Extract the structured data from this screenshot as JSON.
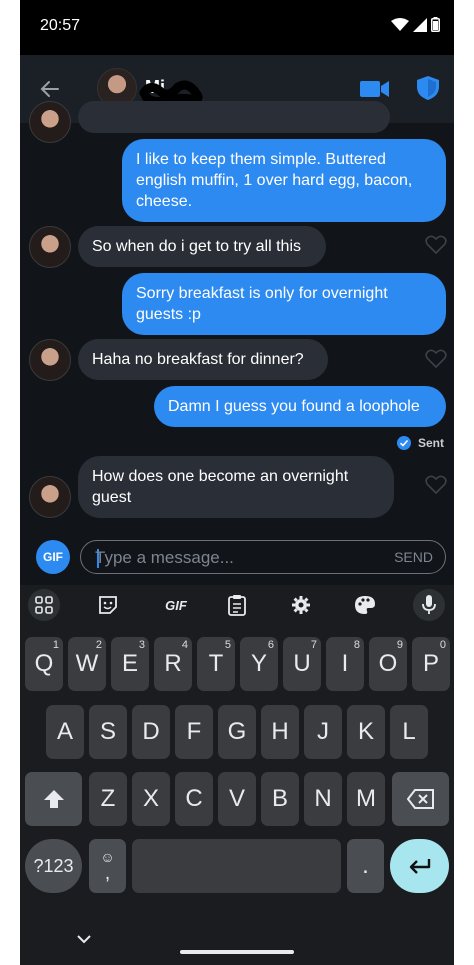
{
  "status": {
    "time": "20:57"
  },
  "header": {
    "contact_name": "Mi"
  },
  "messages": [
    {
      "dir": "out",
      "text": "I like to keep them simple. Buttered english muffin, 1 over hard egg, bacon, cheese."
    },
    {
      "dir": "in",
      "text": "So when do i get to try all this"
    },
    {
      "dir": "out",
      "text": "Sorry breakfast is only for overnight guests :p"
    },
    {
      "dir": "in",
      "text": "Haha no breakfast for dinner?"
    },
    {
      "dir": "out",
      "text": "Damn I guess you found a loophole"
    },
    {
      "dir": "in",
      "text": "How does one become an overnight guest"
    }
  ],
  "sent_label": "Sent",
  "composer": {
    "gif_label": "GIF",
    "placeholder": "Type a message...",
    "send_label": "SEND"
  },
  "keyboard": {
    "toolbar_gif": "GIF",
    "row1": [
      {
        "k": "Q",
        "h": "1"
      },
      {
        "k": "W",
        "h": "2"
      },
      {
        "k": "E",
        "h": "3"
      },
      {
        "k": "R",
        "h": "4"
      },
      {
        "k": "T",
        "h": "5"
      },
      {
        "k": "Y",
        "h": "6"
      },
      {
        "k": "U",
        "h": "7"
      },
      {
        "k": "I",
        "h": "8"
      },
      {
        "k": "O",
        "h": "9"
      },
      {
        "k": "P",
        "h": "0"
      }
    ],
    "row2": [
      "A",
      "S",
      "D",
      "F",
      "G",
      "H",
      "J",
      "K",
      "L"
    ],
    "row3": [
      "Z",
      "X",
      "C",
      "V",
      "B",
      "N",
      "M"
    ],
    "sym_label": "?123",
    "emoji_key": "☺",
    "comma": ",",
    "period": "."
  },
  "colors": {
    "accent": "#2d8af0",
    "bubble_in": "#2a2f37",
    "bg": "#111418",
    "enter_key": "#a8e6ef"
  }
}
